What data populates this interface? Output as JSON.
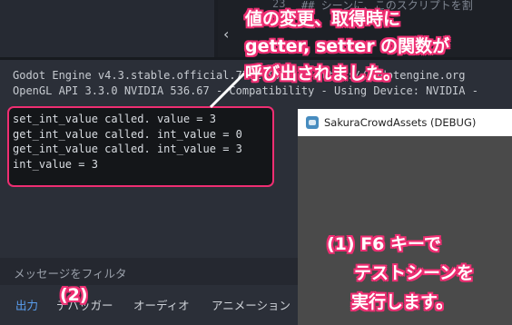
{
  "editor": {
    "line_number": "23",
    "code_line": "## シーンに、このスクリプトを割",
    "collapse_glyph": "‹"
  },
  "output": {
    "header_lines": [
      "Godot Engine v4.3.stable.official.77dcf97d8 - https://godotengine.org",
      "OpenGL API 3.3.0 NVIDIA 536.67 - Compatibility - Using Device: NVIDIA -"
    ],
    "log_lines": [
      "set_int_value called. value = 3",
      "get_int_value called. int_value = 0",
      "get_int_value called. int_value = 3",
      "int_value = 3"
    ],
    "filter_placeholder": "メッセージをフィルタ",
    "tabs": [
      "出力",
      "デバッガー",
      "オーディオ",
      "アニメーション"
    ]
  },
  "game_window": {
    "title": "SakuraCrowdAssets (DEBUG)"
  },
  "annotations": {
    "getter_note": [
      "値の変更、取得時に",
      "getter, setter の関数が",
      "呼び出されました。"
    ],
    "run_note": [
      "(1) F6 キーで",
      "テストシーンを",
      "実行します。"
    ],
    "tab_note": "(2)"
  },
  "colors": {
    "accent_pink": "#ee2e72",
    "active_tab": "#5a9ff0"
  }
}
